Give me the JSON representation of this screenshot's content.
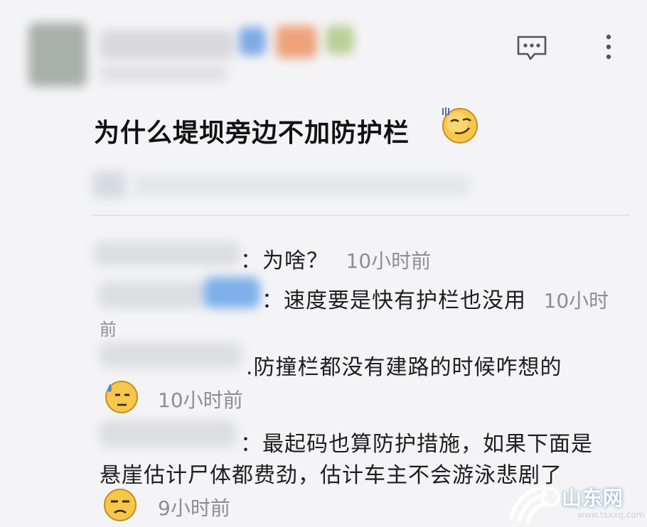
{
  "post": {
    "title": "为什么堤坝旁边不加防护栏"
  },
  "comments": [
    {
      "text": "：为啥？",
      "time": "10小时前"
    },
    {
      "text": "：速度要是快有护栏也没用",
      "time": "10小时",
      "time_wrap": "前"
    },
    {
      "text": ".防撞栏都没有建路的时候咋想的",
      "time": "10小时前"
    },
    {
      "text": "：最起码也算防护措施，如果下面是",
      "text_line2": "悬崖估计尸体都费劲，估计车主不会游泳悲剧了",
      "time": "9小时前"
    }
  ],
  "icons": {
    "header_comment": "comment-bubble-icon",
    "header_more": "more-vertical-icon",
    "title_emoji": "smirk-emoji-icon",
    "comment3_emoji": "sweat-emoji-icon",
    "comment4_emoji": "unamused-emoji-icon"
  },
  "watermark": {
    "brand": "山东网",
    "url": "www.tsxxq.com"
  },
  "colors": {
    "background": "#f4f4f6",
    "time_gray": "#8d8d93",
    "text": "#1d1d1f"
  }
}
